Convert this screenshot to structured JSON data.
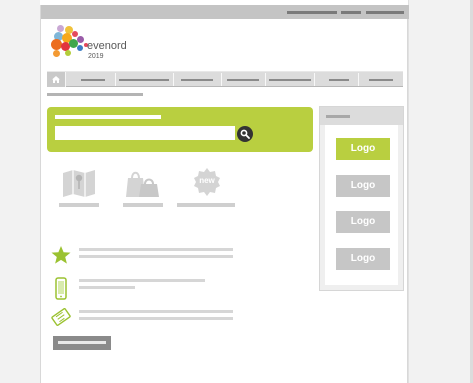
{
  "brand": {
    "name": "evenord",
    "year": "2019"
  },
  "search": {
    "placeholder": "",
    "button_icon": "search-icon"
  },
  "colors": {
    "accent": "#b9cf40",
    "logo_box_accent": "#b9cf40",
    "logo_box_muted": "#c6c6c6"
  },
  "sidebar": {
    "logos": [
      {
        "label": "Logo",
        "state": "active"
      },
      {
        "label": "Logo",
        "state": "inactive"
      },
      {
        "label": "Logo",
        "state": "inactive"
      },
      {
        "label": "Logo",
        "state": "inactive"
      }
    ]
  },
  "features": [
    {
      "icon": "map-icon"
    },
    {
      "icon": "shopping-bag-icon"
    },
    {
      "icon": "new-badge-icon",
      "badge_text": "new"
    }
  ],
  "list": [
    {
      "icon": "star-icon"
    },
    {
      "icon": "mobile-phone-icon"
    },
    {
      "icon": "ticket-icon"
    }
  ]
}
